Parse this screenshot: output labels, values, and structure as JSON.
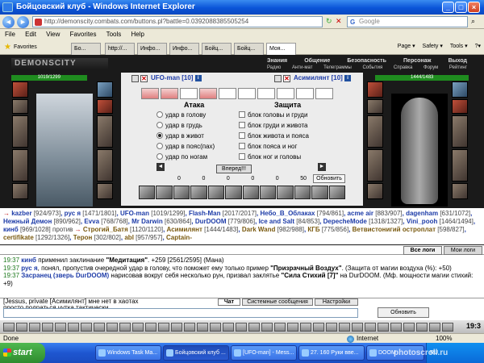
{
  "window": {
    "title": "Бойцовский клуб - Windows Internet Explorer",
    "min": "_",
    "max": "□",
    "close": "×"
  },
  "address": {
    "url": "http://demonscity.combats.com/buttons.pl?battle=0.0392088385505254",
    "search_placeholder": "Google",
    "search_engine": "G"
  },
  "menu": [
    "File",
    "Edit",
    "View",
    "Favorites",
    "Tools",
    "Help"
  ],
  "favorites_label": "Favorites",
  "tabs": [
    "Бо...",
    "http://...",
    "Инфо...",
    "Инфо...",
    "Бойц...",
    "Бойц...",
    "Моя..."
  ],
  "commands": [
    "Page ▾",
    "Safety ▾",
    "Tools ▾",
    "?▾"
  ],
  "game": {
    "logo": "DEMONSCITY",
    "top_menu": [
      "Знания",
      "Общение",
      "Безопасность",
      "Персонаж",
      "Выход"
    ],
    "sub_menu": [
      "Радио",
      "Анти-мат",
      "Телеграммы",
      "События",
      "Справка",
      "Форум",
      "Рейтинг"
    ],
    "left_hp": "1019/1299",
    "right_hp": "1444/1483",
    "left_hp_fraction": 0.78,
    "right_hp_fraction": 0.97,
    "fighter_left": "UFO-man",
    "fighter_left_level": "[10]",
    "vs": "против",
    "fighter_right": "Асимилянт",
    "fighter_right_level": "[10]",
    "level_icon": "i",
    "attack_title": "Атака",
    "defense_title": "Защита",
    "attack_options": [
      "удар в голову",
      "удар в грудь",
      "удар в живот",
      "удар в пояс(пах)",
      "удар по ногам"
    ],
    "attack_selected": 2,
    "defense_options": [
      "блок головы и груди",
      "блок груди и живота",
      "блок живота и пояса",
      "блок пояса и ног",
      "блок ног и головы"
    ],
    "forward_button": "Вперед!!!",
    "update_button": "Обновить",
    "arrow_left": "◄",
    "arrow_right": "►",
    "counters": [
      "0",
      "0",
      "0",
      "0",
      "0",
      "50"
    ]
  },
  "roster": {
    "arrow": "→",
    "left": [
      {
        "name": "kazber",
        "hp": "[924/973]"
      },
      {
        "name": "рус я",
        "hp": "[1471/1801]"
      },
      {
        "name": "UFO-man",
        "hp": "[1019/1299]"
      },
      {
        "name": "Flash-Man",
        "hp": "[2017/2017]"
      },
      {
        "name": "Небо_В_Облаках",
        "hp": "[794/861]"
      },
      {
        "name": "acme air",
        "hp": "[883/907]"
      },
      {
        "name": "dagenham",
        "hp": "[631/1072]"
      },
      {
        "name": "Нежный Демон",
        "hp": "[890/962]"
      },
      {
        "name": "Evva",
        "hp": "[768/768]"
      },
      {
        "name": "Mr Darwin",
        "hp": "[630/864]"
      },
      {
        "name": "DurDOOM",
        "hp": "[779/806]"
      },
      {
        "name": "Ice and Salt",
        "hp": "[84/853]"
      },
      {
        "name": "DepecheMode",
        "hp": "[1318/1327]"
      },
      {
        "name": "Vini_pooh",
        "hp": "[1464/1494]"
      },
      {
        "name": "кинб",
        "hp": "[969/1028]"
      }
    ],
    "vs": "против",
    "right": [
      {
        "name": "Строгий_Батя",
        "hp": "[1120/1120]"
      },
      {
        "name": "Асимилянт",
        "hp": "[1444/1483]"
      },
      {
        "name": "Dark Wand",
        "hp": "[982/988]"
      },
      {
        "name": "КГБ",
        "hp": "[775/856]"
      },
      {
        "name": "Ветвистонигий остроплат",
        "hp": "[598/827]"
      },
      {
        "name": "certifikate",
        "hp": "[1292/1326]"
      },
      {
        "name": "Терон",
        "hp": "[302/802]"
      },
      {
        "name": "abl",
        "hp": "[957/957]"
      },
      {
        "name": "Captain-",
        "hp": ""
      }
    ]
  },
  "log_tabs": [
    "Все логи",
    "Мои логи"
  ],
  "log": [
    {
      "time": "19:37",
      "actor": "кинб",
      "text": " применил заклинание ",
      "bold": "\"Медитация\"",
      "tail": ". +259 [2561/2595] (Мана)"
    },
    {
      "time": "19:37",
      "actor": "рус я",
      "text": ", понял, пропустив очередной удар в голову, что поможет ему только пример ",
      "bold": "\"Призрачный Воздух\"",
      "tail": ". (Защита от магии воздуха (%): +50)"
    },
    {
      "time": "19:37",
      "actor": "Засранец (зверь DurDOOM)",
      "text": " нарисовав вокруг себя несколько рун, призвал заклятье ",
      "bold": "\"Сила Стихий [7]\"",
      "tail": " на DurDOOM. (Мф. мощности магии стихий: +9)"
    }
  ],
  "chat": {
    "lines": [
      {
        "time": "",
        "who": "",
        "text": "[Jessus, private [Асимилянт] мне нет в хаотах"
      },
      {
        "time": "",
        "who": "",
        "text": "просто подраться чутка тактически"
      },
      {
        "time": "19:38",
        "who": "[Асимилянт] private [ Jessus, UFO-man ]",
        "text": " да хот апы до 20 добить"
      }
    ],
    "tabs": [
      "Чат",
      "Системные сообщения",
      "Настройки"
    ],
    "refresh": "Обновить",
    "clock": "19:3"
  },
  "status": {
    "text": "Done",
    "zone": "Internet",
    "zoom": "100%"
  },
  "taskbar": {
    "start": "start",
    "items": [
      "Windows Task Ma...",
      "Бойцовский клуб ...",
      "[UFO-man] - Mess...",
      "27. 160 Руки вве...",
      "DOOM"
    ],
    "tray": "RU"
  },
  "watermark": "photoscroll.ru"
}
